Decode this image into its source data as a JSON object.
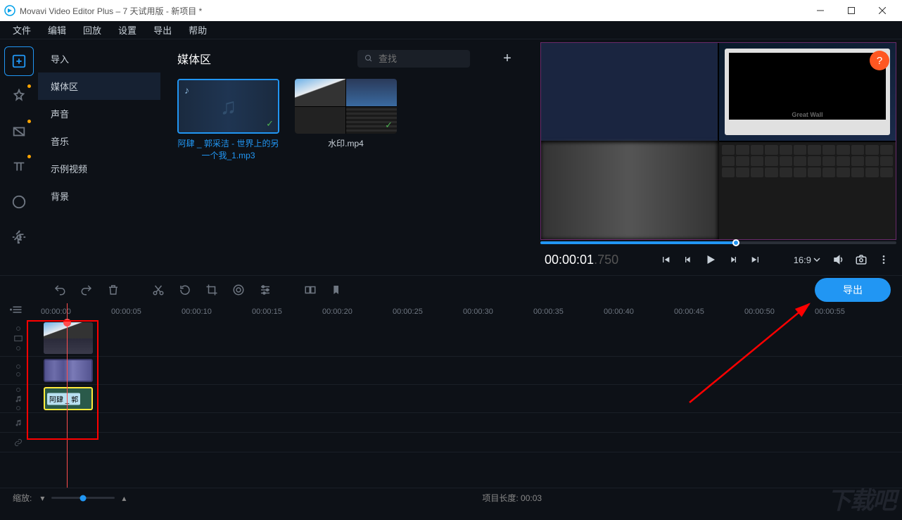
{
  "titlebar": {
    "title": "Movavi Video Editor Plus – 7 天试用版 - 新项目 *"
  },
  "menu": {
    "file": "文件",
    "edit": "编辑",
    "playback": "回放",
    "settings": "设置",
    "export": "导出",
    "help": "帮助"
  },
  "sidebar": {
    "import": "导入",
    "media": "媒体区",
    "sound": "声音",
    "music": "音乐",
    "sample": "示例视频",
    "bg": "背景"
  },
  "mediapanel": {
    "title": "媒体区",
    "search_ph": "查找",
    "items": [
      {
        "label": "阿肆 _ 郭采洁 - 世界上的另一个我_1.mp3"
      },
      {
        "label": "水印.mp4"
      }
    ]
  },
  "preview": {
    "time_main": "00:00:01",
    "time_frac": ".750",
    "ratio": "16:9",
    "brand": "Great Wall"
  },
  "toolbar": {
    "export": "导出"
  },
  "ruler": [
    "00:00:00",
    "00:00:05",
    "00:00:10",
    "00:00:15",
    "00:00:20",
    "00:00:25",
    "00:00:30",
    "00:00:35",
    "00:00:40",
    "00:00:45",
    "00:00:50",
    "00:00:55"
  ],
  "audiotrack": {
    "clip_label": "阿肆 _ 郭"
  },
  "status": {
    "zoom_label": "缩放:",
    "projlen_label": "项目长度:",
    "projlen_val": "00:03"
  },
  "watermark": "下载吧"
}
